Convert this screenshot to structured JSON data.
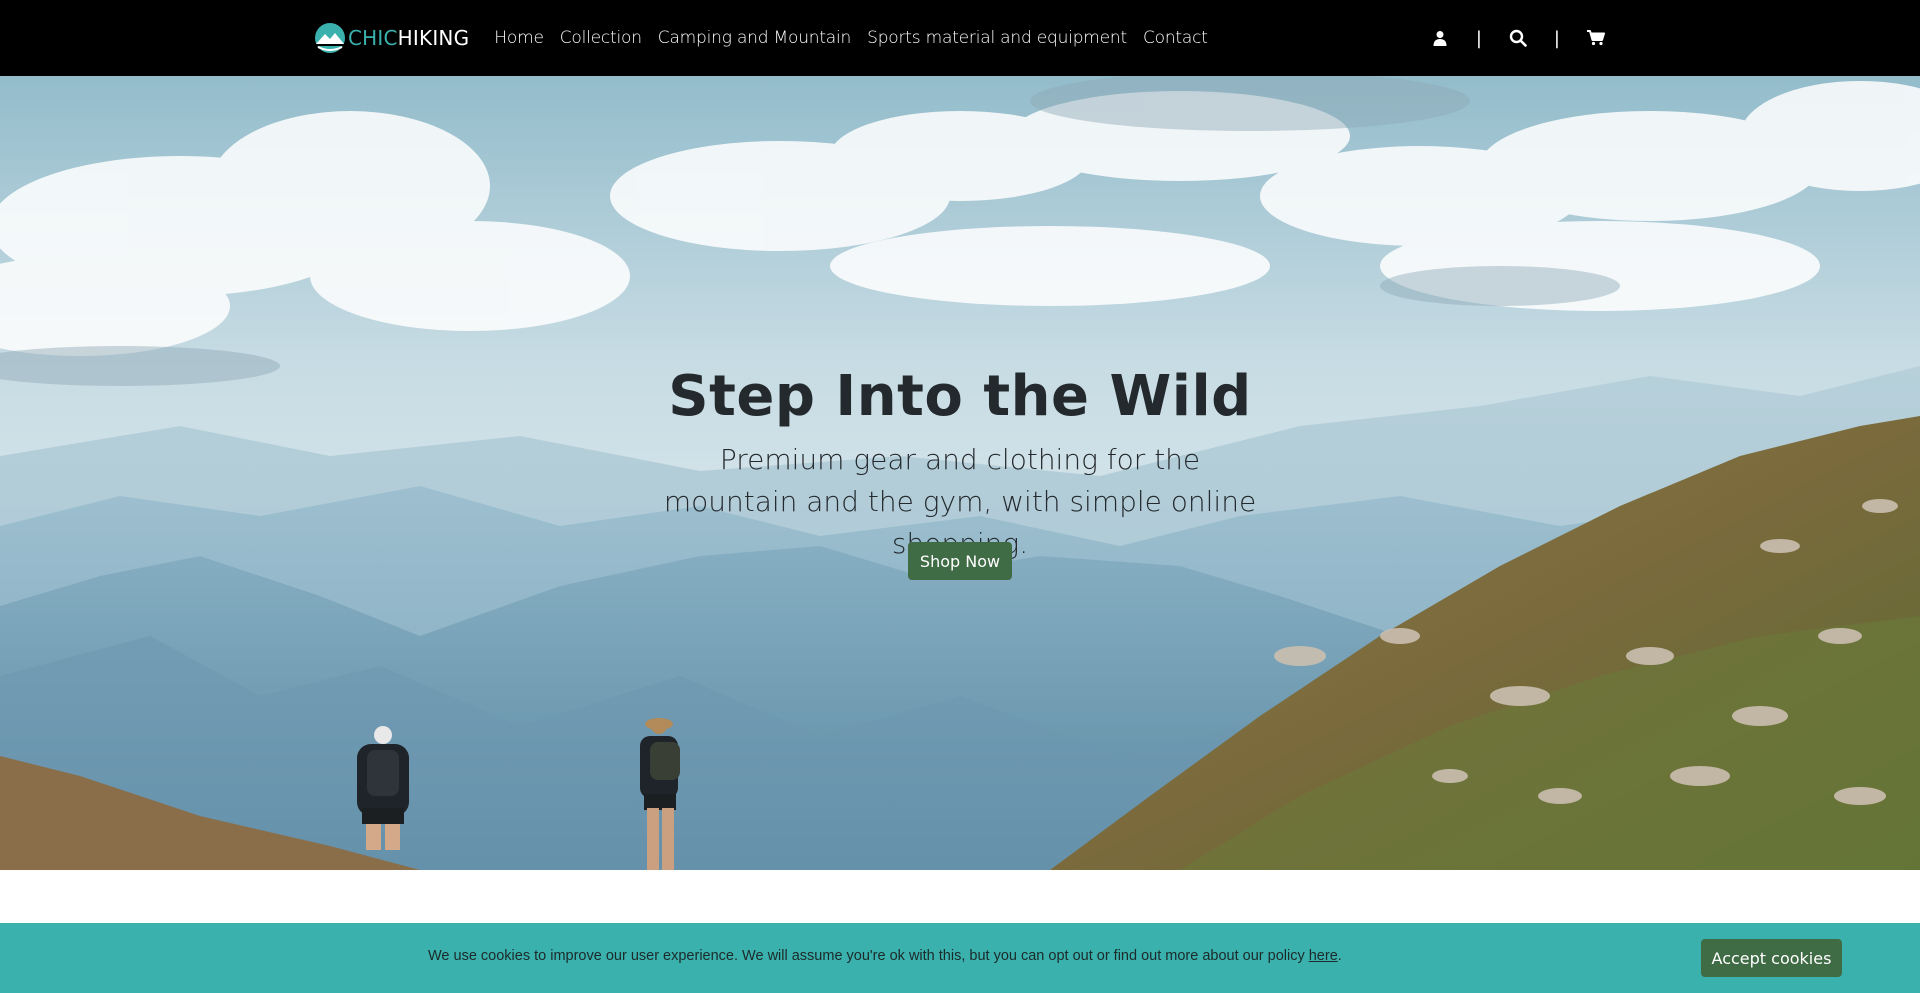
{
  "brand": {
    "chic": "CHIC",
    "hiking": "HIKING",
    "logo_icon": "mountain-sun-logo-icon"
  },
  "nav": {
    "items": [
      {
        "label": "Home"
      },
      {
        "label": "Collection"
      },
      {
        "label": "Camping and Mountain"
      },
      {
        "label": "Sports material and equipment"
      },
      {
        "label": "Contact"
      }
    ],
    "icons": [
      "user-icon",
      "search-icon",
      "cart-icon"
    ],
    "separator": "|"
  },
  "hero": {
    "title": "Step Into the Wild",
    "subtitle": "Premium gear and clothing for the mountain and the gym, with simple online shopping.",
    "cta_label": "Shop Now"
  },
  "cookie": {
    "text": "We use cookies to improve our user experience. We will assume you're ok with this, but you can opt out or find out more about our policy ",
    "link_label": "here",
    "after_link": ".",
    "accept_label": "Accept cookies"
  },
  "colors": {
    "accent_teal": "#3bb1ad",
    "button_green": "#3f6b45",
    "navbar_bg": "#000000"
  }
}
